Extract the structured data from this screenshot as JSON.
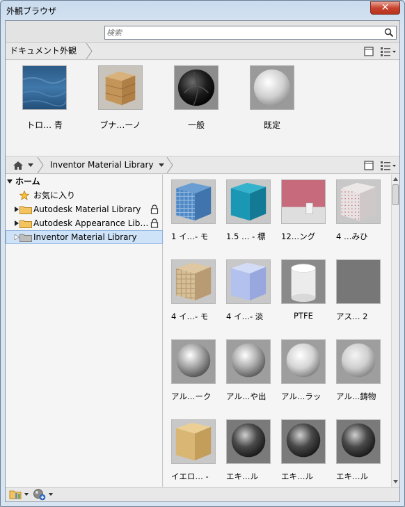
{
  "window": {
    "title": "外観ブラウザ",
    "close_label": "✕"
  },
  "search": {
    "placeholder": "検索",
    "value": ""
  },
  "document_bar": {
    "title": "ドキュメント外観"
  },
  "document_items": [
    {
      "label": "トロ… 青"
    },
    {
      "label": "ブナ…ーノ"
    },
    {
      "label": "一般"
    },
    {
      "label": "既定"
    }
  ],
  "library_bar": {
    "home_label": "",
    "library_label": "Inventor Material Library"
  },
  "tree": {
    "root": "ホーム",
    "favorites": "お気に入り",
    "items": [
      {
        "label": "Autodesk Material Library",
        "locked": true
      },
      {
        "label": "Autodesk Appearance Lib…",
        "locked": true
      },
      {
        "label": "Inventor Material Library",
        "locked": false
      }
    ]
  },
  "materials": [
    {
      "label": "1 イ…- モ"
    },
    {
      "label": "1.5 … - 標"
    },
    {
      "label": "12…ング"
    },
    {
      "label": "4 …みひ"
    },
    {
      "label": "4 イ…- モ"
    },
    {
      "label": "4 イ…- 淡"
    },
    {
      "label": "PTFE"
    },
    {
      "label": "アス… 2"
    },
    {
      "label": "アル…ーク"
    },
    {
      "label": "アル…や出"
    },
    {
      "label": "アル…ラッ"
    },
    {
      "label": "アル…鋳物"
    },
    {
      "label": "イエロ… -"
    },
    {
      "label": "エキ…ル"
    },
    {
      "label": "エキ…ル"
    },
    {
      "label": "エキ…ル"
    }
  ]
}
